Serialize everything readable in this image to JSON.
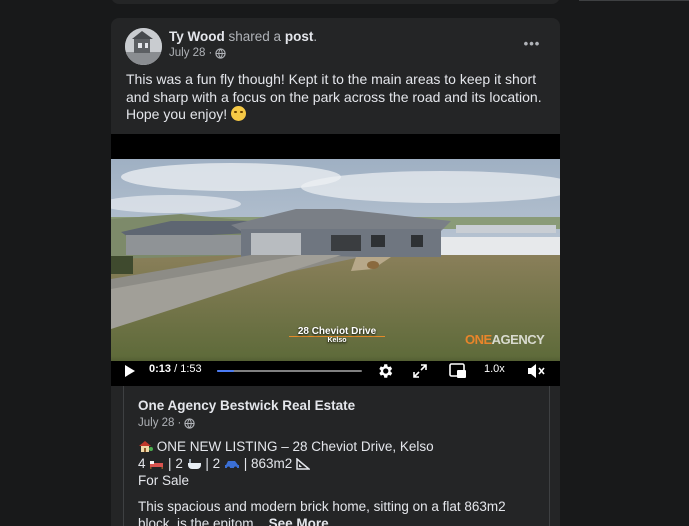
{
  "post": {
    "author": "Ty Wood",
    "action": "shared a",
    "object": "post",
    "date": "July 28",
    "separator": "·",
    "more_label": "•••",
    "text": "This was a fun fly though! Kept it to the main areas to keep it short and sharp with a focus on the park across the road and its location. Hope you enjoy!",
    "emoji": "grimacing-face-emoji"
  },
  "video": {
    "overlay_address": "28 Cheviot Drive",
    "overlay_suburb": "Kelso",
    "brand_one": "ONE",
    "brand_agency": "AGENCY",
    "current_time": "0:13",
    "time_separator": " / ",
    "duration": "1:53",
    "progress": 0.115,
    "speed": "1.0x",
    "icons": [
      "play-icon",
      "settings-icon",
      "fullscreen-icon",
      "picture-in-picture-icon",
      "mute-icon"
    ]
  },
  "shared_post": {
    "page_name": "One Agency Bestwick Real Estate",
    "date": "July 28",
    "separator": "·",
    "listing_title": "ONE NEW LISTING – 28 Cheviot Drive, Kelso",
    "beds": "4",
    "baths": "2",
    "cars": "2",
    "area": "863m2",
    "bar": "|",
    "status": "For Sale",
    "description": "This spacious and modern brick home, sitting on a flat 863m2 block, is the epitom...",
    "see_more": "See More"
  },
  "colors": {
    "background": "#18191a",
    "card": "#242526",
    "accent_progress": "#4b7bf3",
    "brand_orange": "#e9852a"
  }
}
